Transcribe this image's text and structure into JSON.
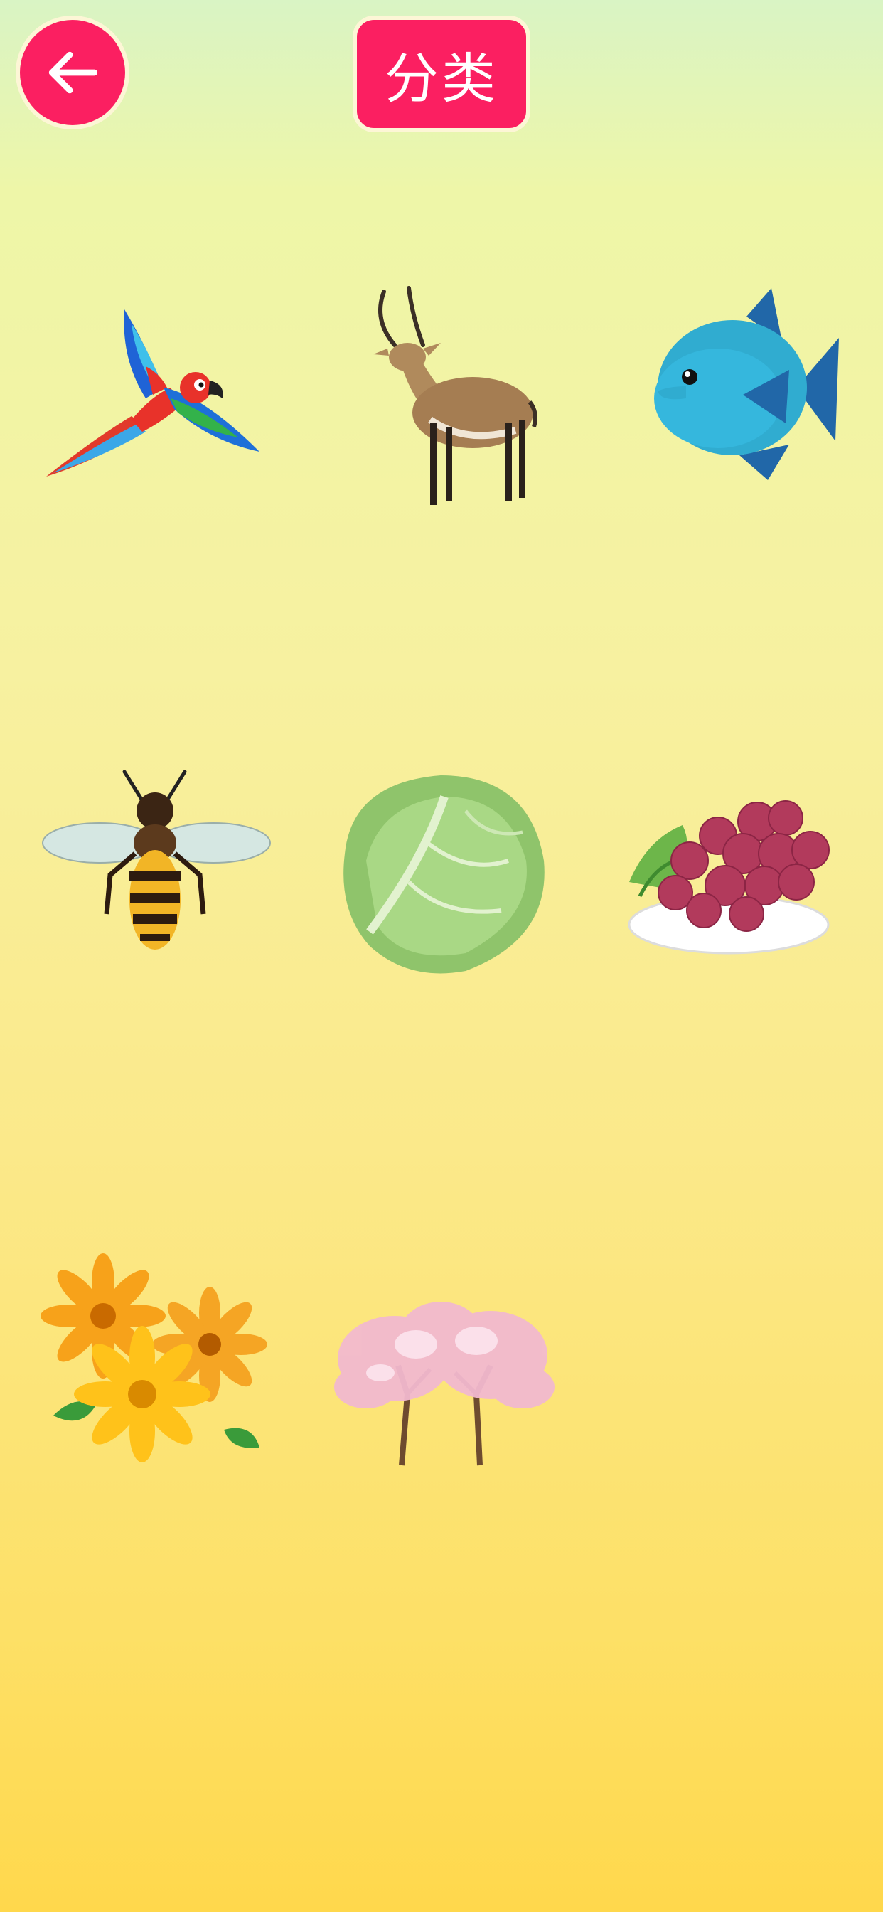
{
  "header": {
    "back_icon": "arrow-left-icon",
    "title": "分类"
  },
  "items": [
    {
      "name": "parrot",
      "icon": "parrot-image"
    },
    {
      "name": "antelope",
      "icon": "antelope-image"
    },
    {
      "name": "fish",
      "icon": "fish-image"
    },
    {
      "name": "bee",
      "icon": "bee-image"
    },
    {
      "name": "cabbage",
      "icon": "cabbage-image"
    },
    {
      "name": "grapes",
      "icon": "grapes-image"
    },
    {
      "name": "flowers",
      "icon": "flowers-image"
    },
    {
      "name": "cherry-blossom-tree",
      "icon": "tree-image"
    }
  ],
  "colors": {
    "accent": "#fb1f61",
    "background_top": "#d9f4c4",
    "background_bottom": "#ffd84c"
  }
}
